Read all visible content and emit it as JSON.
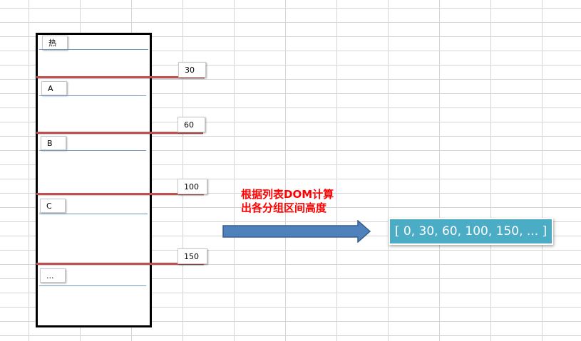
{
  "list": {
    "groups": [
      {
        "label": "热"
      },
      {
        "label": "A"
      },
      {
        "label": "B"
      },
      {
        "label": "C"
      },
      {
        "label": "..."
      }
    ]
  },
  "boundaries": [
    {
      "value": "30"
    },
    {
      "value": "60"
    },
    {
      "value": "100"
    },
    {
      "value": "150"
    }
  ],
  "note": {
    "line1": "根据列表DOM计算",
    "line2": "出各分组区间高度"
  },
  "result": {
    "text": "[ 0, 30, 60, 100, 150, ... ]"
  },
  "colors": {
    "boundary_line": "#c0504d",
    "separator_line": "#6e94c4",
    "note_text": "#ff0000",
    "arrow_fill": "#4f81bd",
    "result_bg": "#4bacc6"
  }
}
